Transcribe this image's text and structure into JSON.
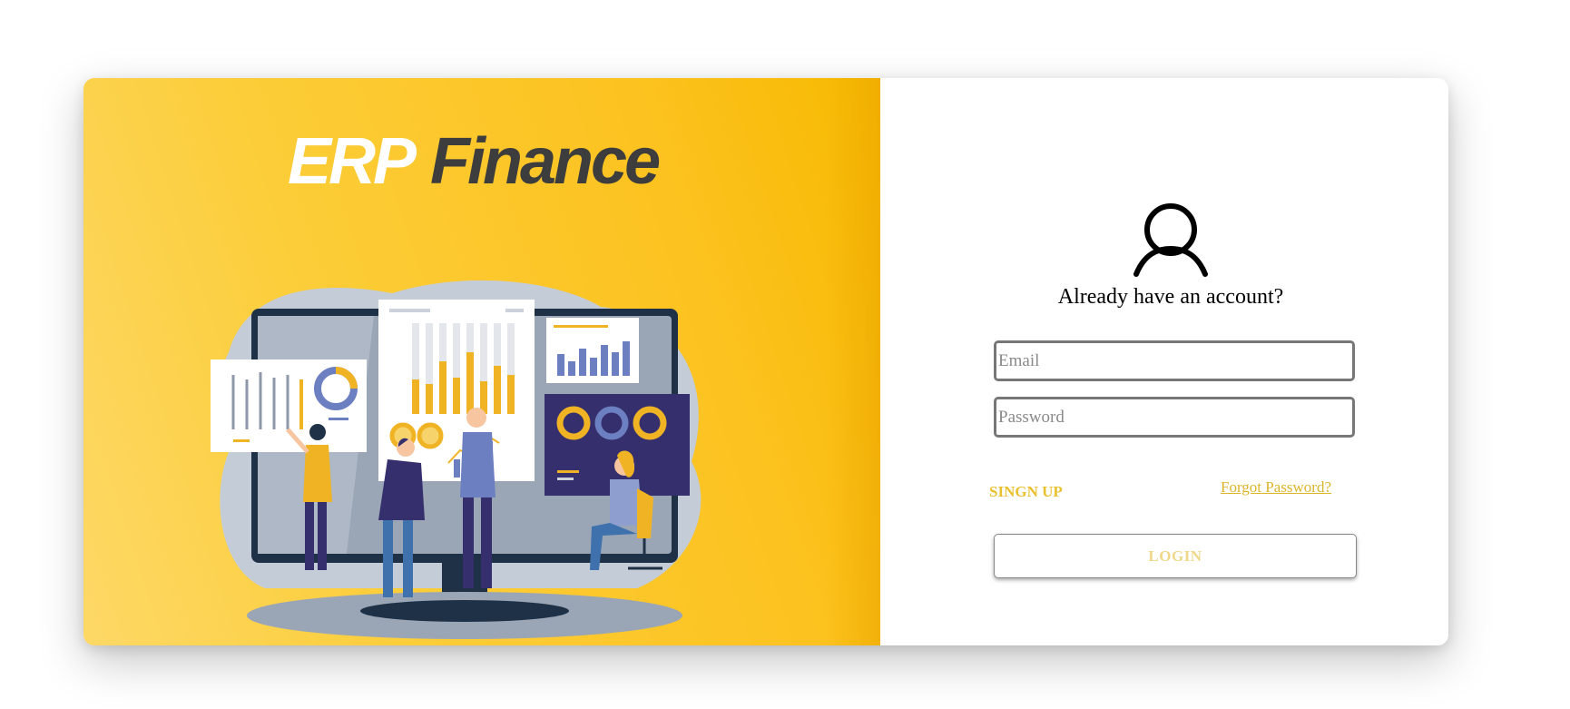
{
  "brand": {
    "logo_part1": "ERP",
    "logo_part2": "Finance",
    "accent_color": "#fcc21f",
    "logo_dark_color": "#3d3d3d"
  },
  "hero": {
    "illustration": "finance-team-dashboard-illustration"
  },
  "login_form": {
    "avatar_icon": "user-icon",
    "title": "Already have an account?",
    "email_placeholder": "Email",
    "email_value": "",
    "password_placeholder": "Password",
    "password_value": "",
    "signup_label": "SINGN UP",
    "forgot_label": "Forgot Password?",
    "login_label": "LOGIN",
    "link_color": "#e9c130"
  }
}
